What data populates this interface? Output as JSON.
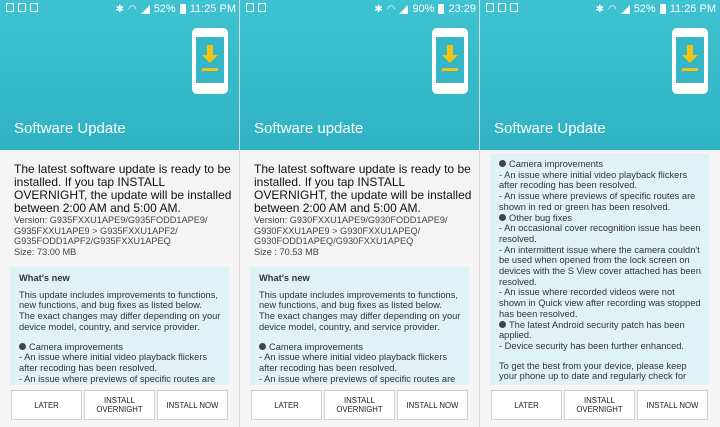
{
  "panels": [
    {
      "status": {
        "battery": "52%",
        "time": "11:25 PM"
      },
      "title": "Software Update",
      "message": "The latest software update is ready to be installed. If you tap INSTALL OVERNIGHT, the update will be installed between 2:00 AM and 5:00 AM.",
      "version_lines": [
        "Version: G935FXXU1APE9/G935FODD1APE9/",
        "G935FXXU1APE9 > G935FXXU1APF2/",
        "G935FODD1APF2/G935FXXU1APEQ"
      ],
      "size": "Size: 73.00 MB",
      "whats_new": {
        "heading": "What's new",
        "lines": [
          "This update includes improvements to functions,",
          "new functions, and bug fixes as listed below.",
          "The exact changes may differ depending on your",
          "device model, country, and service provider."
        ],
        "bullet": "Camera improvements",
        "sub_lines": [
          "- An issue where initial video playback flickers",
          "after recoding has been resolved.",
          "- An issue where previews of specific routes are"
        ]
      },
      "buttons": {
        "later": "LATER",
        "overnight_1": "INSTALL",
        "overnight_2": "OVERNIGHT",
        "now": "INSTALL NOW"
      }
    },
    {
      "status": {
        "battery": "90%",
        "time": "23:29"
      },
      "title": "Software update",
      "message": "The latest software update is ready to be installed. If you tap INSTALL OVERNIGHT, the update will be installed between 2:00 AM and 5:00 AM.",
      "version_lines": [
        "Version: G930FXXU1APE9/G930FODD1APE9/",
        "G930FXXU1APE9 > G930FXXU1APEQ/",
        "G930FODD1APEQ/G930FXXU1APEQ"
      ],
      "size": "Size : 70.53 MB",
      "whats_new": {
        "heading": "What's new",
        "lines": [
          "This update includes improvements to functions,",
          "new functions, and bug fixes as listed below.",
          "The exact changes may differ depending on your",
          "device model, country, and service provider."
        ],
        "bullet": "Camera improvements",
        "sub_lines": [
          "- An issue where initial video playback flickers",
          "after recoding has been resolved.",
          "- An issue where previews of specific routes are"
        ]
      },
      "buttons": {
        "later": "LATER",
        "overnight_1": "INSTALL",
        "overnight_2": "OVERNIGHT",
        "now": "INSTALL NOW"
      }
    },
    {
      "status": {
        "battery": "52%",
        "time": "11:26 PM"
      },
      "title": "Software Update",
      "list": {
        "camera_bullet": "Camera improvements",
        "camera_lines": [
          "- An issue where initial video playback flickers",
          "after recoding has been resolved.",
          "- An issue where previews of specific routes are",
          "shown in red or green has been resolved."
        ],
        "other_bullet": "Other bug fixes",
        "other_lines": [
          "- An occasional cover recognition issue has been",
          "resolved.",
          "- An intermittent issue where the camera couldn't",
          "be used when opened from the lock screen on",
          "devices with the S View cover attached has been",
          "resolved.",
          "- An issue where recorded videos were not",
          "shown in Quick view after recording was stopped",
          "has been resolved."
        ],
        "android_bullet": "The latest Android security patch has been",
        "android_bullet_2": "applied.",
        "android_lines": [
          "- Device security has been further enhanced."
        ],
        "footer_lines": [
          "To get the best from your device, please keep",
          "your phone up to date and regularly check for"
        ]
      },
      "buttons": {
        "later": "LATER",
        "overnight_1": "INSTALL",
        "overnight_2": "OVERNIGHT",
        "now": "INSTALL NOW"
      }
    }
  ]
}
